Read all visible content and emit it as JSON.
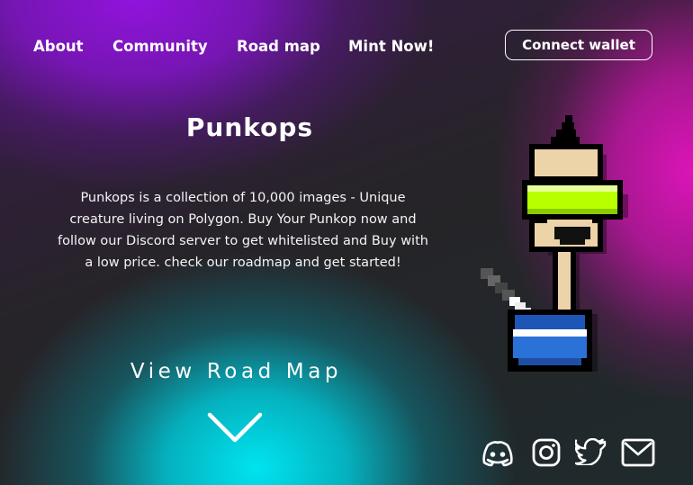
{
  "nav": {
    "about": "About",
    "community": "Community",
    "roadmap": "Road map",
    "mint": "Mint Now!"
  },
  "header": {
    "connect_label": "Connect wallet"
  },
  "hero": {
    "title": "Punkops",
    "description": "Punkops is a collection of 10,000 images - Unique creature living on Polygon. Buy Your Punkop now and follow our Discord server to get whitelisted and Buy with a low price. check our roadmap and get started!",
    "cta": "View Road Map"
  },
  "social": {
    "icons": [
      "discord-icon",
      "instagram-icon",
      "twitter-icon",
      "mail-icon"
    ]
  },
  "colors": {
    "purple_glow": "#8c14dc",
    "magenta_glow": "#dc14b9",
    "cyan_glow": "#00e4f0",
    "visor": "#b8ff00",
    "bowl": "#2a72d8"
  }
}
